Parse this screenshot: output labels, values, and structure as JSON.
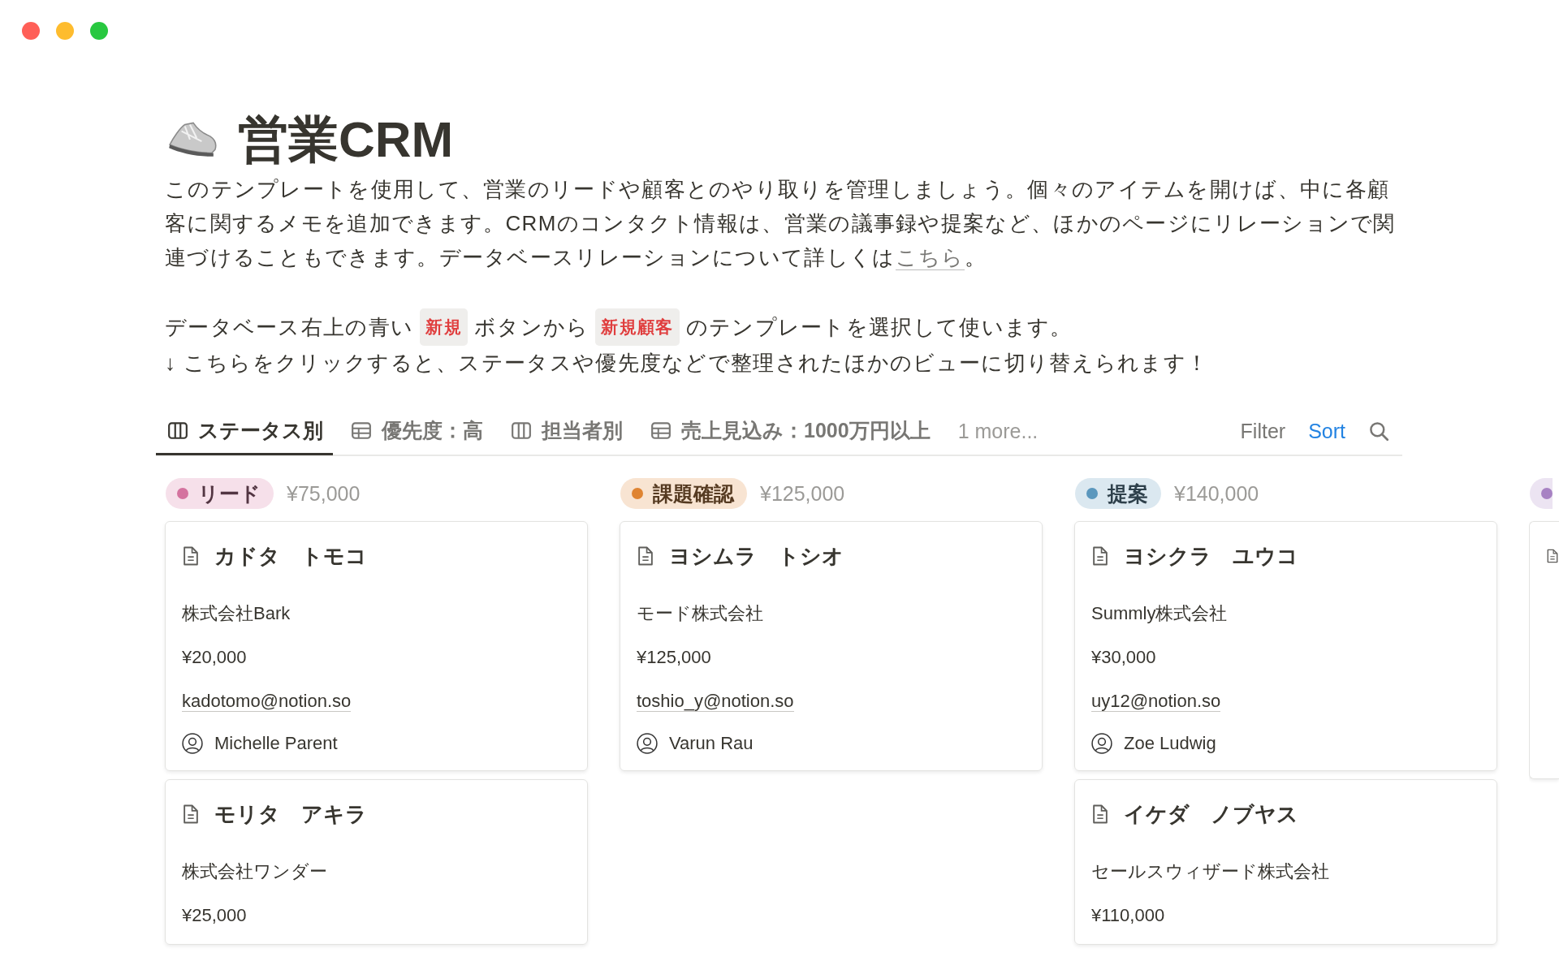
{
  "window": {
    "controls": [
      {
        "color": "#ff5f57"
      },
      {
        "color": "#febc2e"
      },
      {
        "color": "#28c840"
      }
    ]
  },
  "page": {
    "title": "営業CRM",
    "intro": {
      "text": "このテンプレートを使用して、営業のリードや顧客とのやり取りを管理しましょう。個々のアイテムを開けば、中に各顧客に関するメモを追加できます。CRMのコンタクト情報は、営業の議事録や提案など、ほかのページにリレーションで関連づけることもできます。データベースリレーションについて詳しくは",
      "link": "こちら",
      "after": "。"
    },
    "guide": [
      {
        "kind": "text",
        "text": "データベース右上の青い"
      },
      {
        "kind": "tag",
        "text": "新規"
      },
      {
        "kind": "text",
        "text": "ボタンから"
      },
      {
        "kind": "tag",
        "text": "新規顧客"
      },
      {
        "kind": "text",
        "text": "のテンプレートを選択して使います。"
      }
    ],
    "hint": "↓ こちらをクリックすると、ステータスや優先度などで整理されたほかのビューに切り替えられます！"
  },
  "views": {
    "tabs": [
      {
        "label": "ステータス別",
        "kind": "board",
        "selected": true
      },
      {
        "label": "優先度：高",
        "kind": "table",
        "selected": false
      },
      {
        "label": "担当者別",
        "kind": "board",
        "selected": false
      },
      {
        "label": "売上見込み：1000万円以上",
        "kind": "table",
        "selected": false
      }
    ],
    "more": "1 more...",
    "actions": [
      {
        "label": "Filter",
        "active": false
      },
      {
        "label": "Sort",
        "active": true
      }
    ]
  },
  "board": {
    "columns": [
      {
        "label": "リード",
        "color": "#d4739f",
        "total": "¥75,000",
        "cards": [
          {
            "title": "カドタ　トモコ",
            "company": "株式会社Bark",
            "amount": "¥20,000",
            "email": "kadotomo@notion.so",
            "owner": "Michelle Parent"
          },
          {
            "title": "モリタ　アキラ",
            "company": "株式会社ワンダー",
            "amount": "¥25,000"
          }
        ]
      },
      {
        "label": "課題確認",
        "color": "#df8432",
        "total": "¥125,000",
        "cards": [
          {
            "title": "ヨシムラ　トシオ",
            "company": "モード株式会社",
            "amount": "¥125,000",
            "email": "toshio_y@notion.so",
            "owner": "Varun Rau"
          }
        ]
      },
      {
        "label": "提案",
        "color": "#5b97bd",
        "total": "¥140,000",
        "cards": [
          {
            "title": "ヨシクラ　ユウコ",
            "company": "Summly株式会社",
            "amount": "¥30,000",
            "email": "uy12@notion.so",
            "owner": "Zoe Ludwig"
          },
          {
            "title": "イケダ　ノブヤス",
            "company": "セールスウィザード株式会社",
            "amount": "¥110,000"
          }
        ]
      },
      {
        "color": "#a782c3",
        "cut_off": true
      }
    ]
  }
}
